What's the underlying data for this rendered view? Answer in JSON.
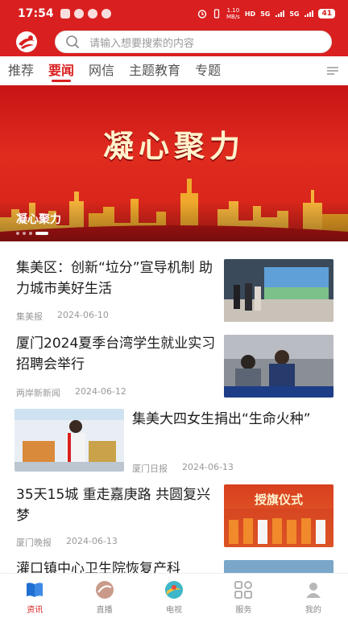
{
  "status": {
    "time": "17:54",
    "speed_top": "1.10",
    "speed_unit": "MB/s",
    "hd": "HD",
    "net1": "5G",
    "net2": "5G",
    "battery": "41"
  },
  "search": {
    "placeholder": "请输入想要搜索的内容"
  },
  "tabs": [
    {
      "label": "推荐",
      "active": false
    },
    {
      "label": "要闻",
      "active": true
    },
    {
      "label": "网信",
      "active": false
    },
    {
      "label": "主题教育",
      "active": false
    },
    {
      "label": "专题",
      "active": false
    }
  ],
  "banner": {
    "headline": "凝心聚力",
    "caption": "凝心聚力",
    "slide_count": 4,
    "active_slide": 3
  },
  "news": [
    {
      "title": "集美区：创新“垃分”宣导机制 助力城市美好生活",
      "source": "集美报",
      "date": "2024-06-10"
    },
    {
      "title": "厦门2024夏季台湾学生就业实习招聘会举行",
      "source": "两岸新新闻",
      "date": "2024-06-12"
    },
    {
      "title": "集美大四女生捐出“生命火种”",
      "source": "厦门日报",
      "date": "2024-06-13"
    },
    {
      "title": "35天15城 重走嘉庚路 共圆复兴梦",
      "source": "厦门晚报",
      "date": "2024-06-13"
    },
    {
      "title": "灌口镇中心卫生院恢复产科",
      "source": "",
      "date": ""
    }
  ],
  "thumb_text": {
    "ceremony": "授旗仪式"
  },
  "bottom_nav": [
    {
      "label": "资讯",
      "icon": "book-icon",
      "active": true
    },
    {
      "label": "直播",
      "icon": "live-icon",
      "active": false
    },
    {
      "label": "电视",
      "icon": "tv-icon",
      "active": false
    },
    {
      "label": "服务",
      "icon": "grid-icon",
      "active": false
    },
    {
      "label": "我的",
      "icon": "profile-icon",
      "active": false
    }
  ],
  "colors": {
    "brand_red": "#d91f1f",
    "text": "#1c1c1c",
    "meta": "#999999"
  }
}
